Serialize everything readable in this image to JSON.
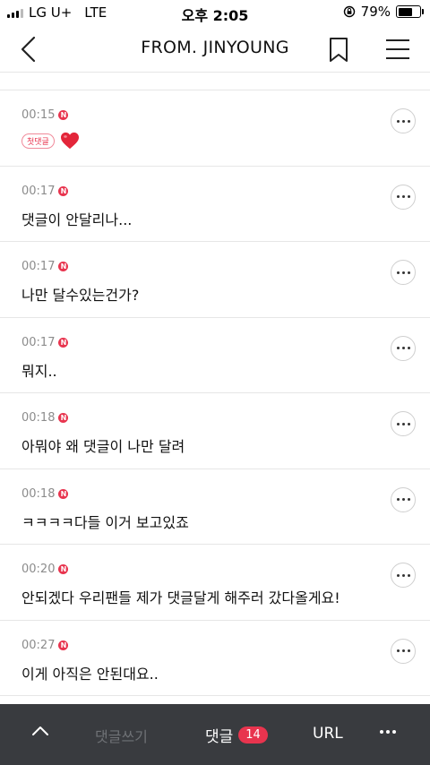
{
  "status_bar": {
    "carrier": "LG U+",
    "network": "LTE",
    "time": "오후 2:05",
    "battery_percent": "79%",
    "battery_level": 0.79
  },
  "nav": {
    "title": "FROM. JINYOUNG",
    "back_icon": "chevron-left-icon",
    "bookmark_icon": "bookmark-icon",
    "menu_icon": "hamburger-menu-icon"
  },
  "comments": [
    {
      "time": "00:15",
      "badge": "N",
      "first_comment_tag": "첫댓글",
      "text": ""
    },
    {
      "time": "00:17",
      "badge": "N",
      "text": "댓글이 안달리나..."
    },
    {
      "time": "00:17",
      "badge": "N",
      "text": "나만 달수있는건가?"
    },
    {
      "time": "00:17",
      "badge": "N",
      "text": "뭐지.."
    },
    {
      "time": "00:18",
      "badge": "N",
      "text": "아뭐야 왜 댓글이 나만 달려"
    },
    {
      "time": "00:18",
      "badge": "N",
      "text": "ㅋㅋㅋㅋ다들 이거 보고있죠"
    },
    {
      "time": "00:20",
      "badge": "N",
      "text": "안되겠다 우리팬들 제가 댓글달게 해주러 갔다올게요!"
    },
    {
      "time": "00:27",
      "badge": "N",
      "text": "이게 아직은 안된대요.."
    }
  ],
  "bottom_bar": {
    "write_label": "댓글쓰기",
    "comment_label": "댓글",
    "comment_count": "14",
    "url_label": "URL"
  },
  "colors": {
    "accent": "#e8344e",
    "bottom_bar_bg": "#393b3f",
    "timestamp": "#8c8c8c"
  }
}
